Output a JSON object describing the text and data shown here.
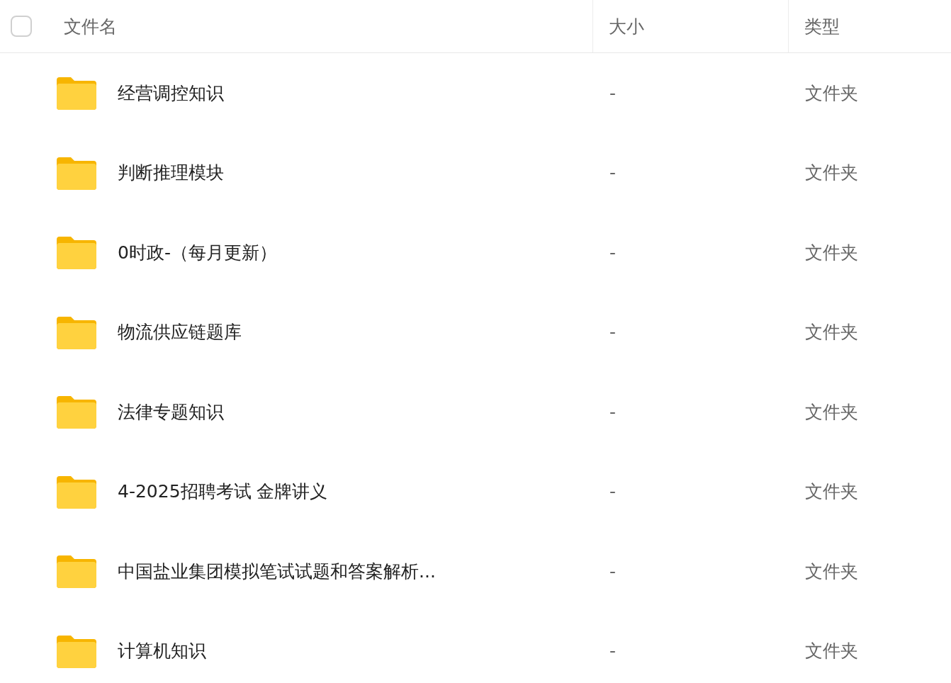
{
  "header": {
    "checked": false,
    "columns": [
      "文件名",
      "大小",
      "类型"
    ]
  },
  "rows": [
    {
      "name": "经营调控知识",
      "size": "-",
      "type": "文件夹"
    },
    {
      "name": "判断推理模块",
      "size": "-",
      "type": "文件夹"
    },
    {
      "name": "0时政-（每月更新）",
      "size": "-",
      "type": "文件夹"
    },
    {
      "name": "物流供应链题库",
      "size": "-",
      "type": "文件夹"
    },
    {
      "name": "法律专题知识",
      "size": "-",
      "type": "文件夹"
    },
    {
      "name": "4-2025招聘考试 金牌讲义",
      "size": "-",
      "type": "文件夹"
    },
    {
      "name": "中国盐业集团模拟笔试试题和答案解析...",
      "size": "-",
      "type": "文件夹"
    },
    {
      "name": "计算机知识",
      "size": "-",
      "type": "文件夹"
    }
  ]
}
